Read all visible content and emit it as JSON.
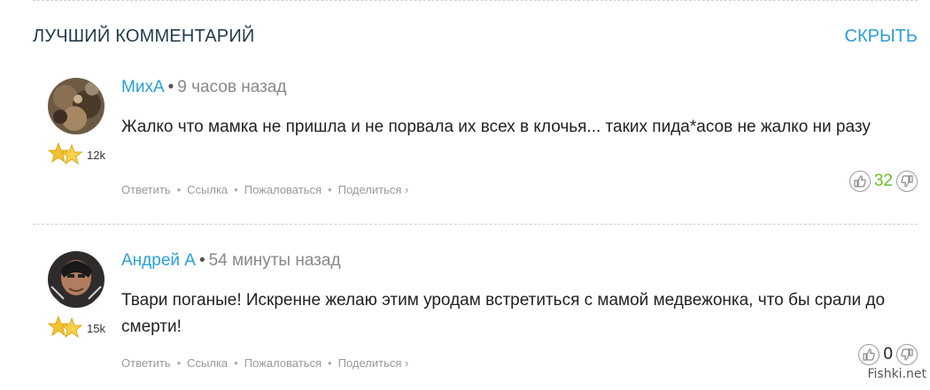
{
  "header": {
    "title": "ЛУЧШИЙ КОММЕНТАРИЙ",
    "hide_label": "СКРЫТЬ"
  },
  "comments": [
    {
      "author": "МихА",
      "time": "9 часов назад",
      "karma": "12k",
      "text": "Жалко что мамка не пришла и не порвала их всех в клочья... таких пида*асов не жалко ни разу",
      "actions": {
        "reply": "Ответить",
        "link": "Ссылка",
        "report": "Пожаловаться",
        "share": "Поделиться ›"
      },
      "score": "32",
      "score_color": "#6bbf2e"
    },
    {
      "author": "Андрей А",
      "time": "54 минуты назад",
      "karma": "15k",
      "text": "Твари поганые! Искренне желаю этим уродам встретиться с мамой медвежонка, что бы срали до смерти!",
      "actions": {
        "reply": "Ответить",
        "link": "Ссылка",
        "report": "Пожаловаться",
        "share": "Поделиться ›"
      },
      "score": "0",
      "score_color": "#222222"
    }
  ],
  "icons": {
    "like": "thumbs-up-icon",
    "dislike": "thumbs-down-icon",
    "rank": "star-icon"
  },
  "watermark": "Fishki.net"
}
